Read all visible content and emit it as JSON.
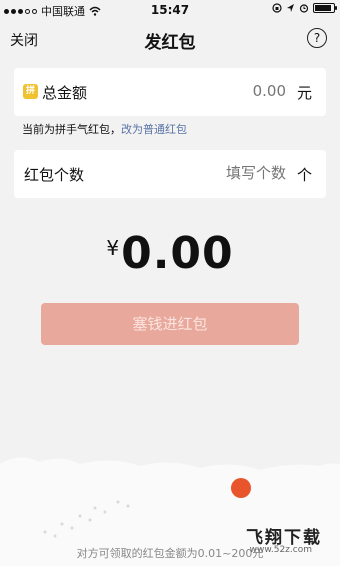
{
  "status_bar": {
    "carrier": "中国联通",
    "time": "15:47"
  },
  "nav": {
    "close_label": "关闭",
    "title": "发红包",
    "help_label": "?"
  },
  "amount_card": {
    "icon_text": "拼",
    "label": "总金额",
    "value": "0.00",
    "unit": "元"
  },
  "hint": {
    "text": "当前为拼手气红包，",
    "link": "改为普通红包"
  },
  "count_card": {
    "label": "红包个数",
    "placeholder": "填写个数",
    "unit": "个"
  },
  "total": {
    "currency": "¥",
    "amount": "0.00"
  },
  "submit_label": "塞钱进红包",
  "footer_text": "对方可领取的红包金额为0.01~200元",
  "watermark": {
    "text": "飞翔下载",
    "url": "www.52z.com"
  },
  "colors": {
    "accent_button": "#e9a89c",
    "link": "#5a74a6",
    "pin_badge": "#f0c230",
    "lantern": "#e8542b"
  }
}
